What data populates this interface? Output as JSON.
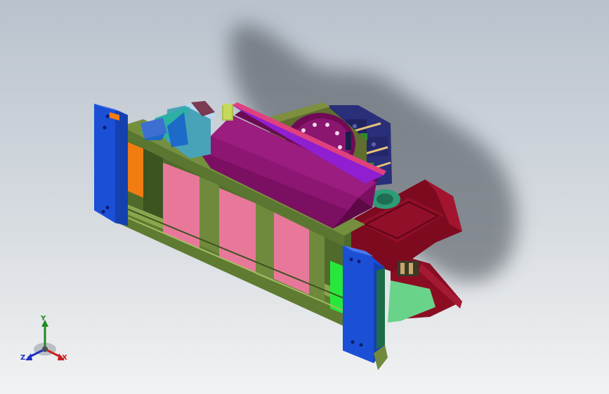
{
  "viewport": {
    "background_top": "#b9c2cd",
    "background_bottom": "#f1f2f3"
  },
  "triad": {
    "x_label": "X",
    "y_label": "Y",
    "z_label": "Z",
    "x_color": "#c82020",
    "y_color": "#1e8a1e",
    "z_color": "#2030c0"
  },
  "model": {
    "frame_color": "#6f8a3c",
    "end_plate_color": "#1b4fd6",
    "roller_color": "#7b0f62",
    "panel_color": "#e8789a",
    "hopper_color": "#8b0d22"
  }
}
